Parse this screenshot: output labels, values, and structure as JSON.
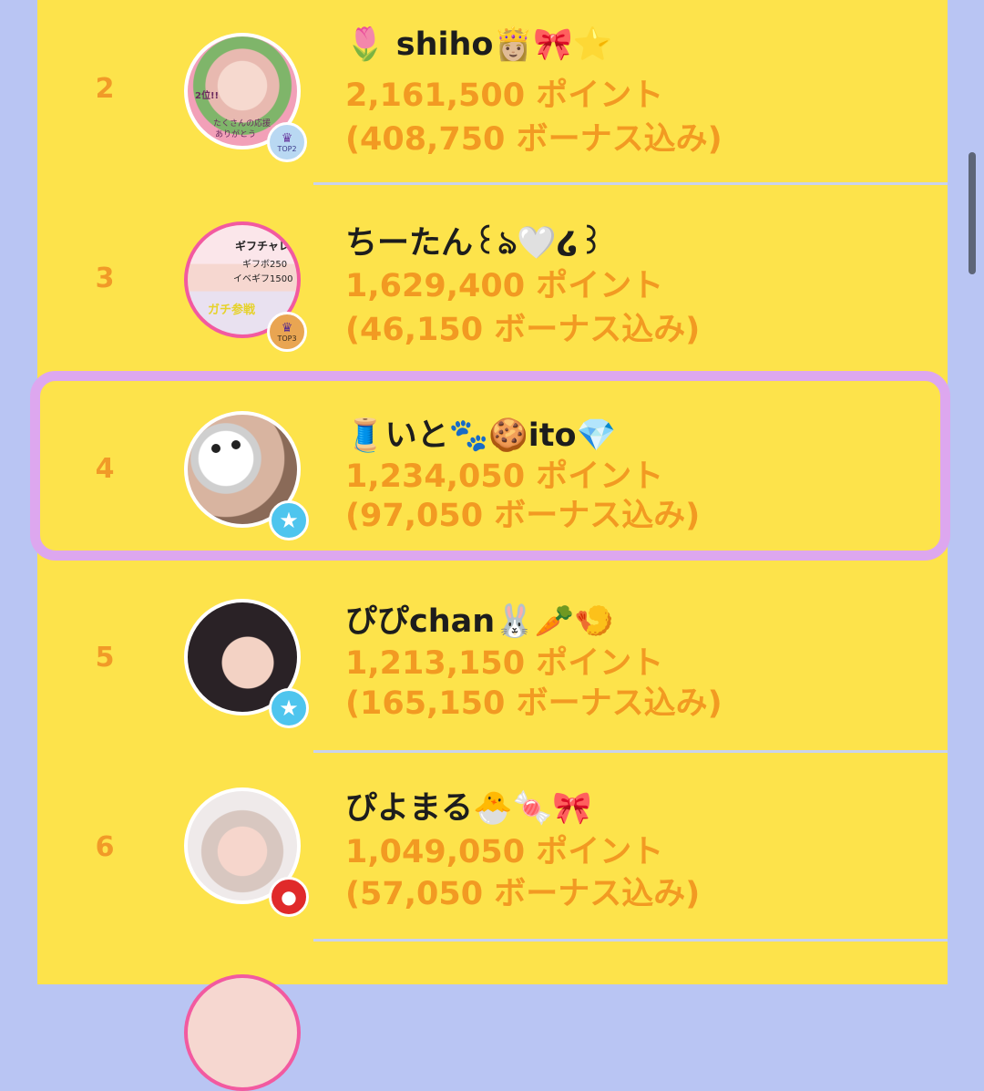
{
  "ranking": [
    {
      "rank": "2",
      "name": "🌷 𝘀𝗵𝗶𝗵𝗼👸🏼🎀⭐️",
      "points": "2,161,500 ポイント",
      "bonus": "(408,750 ボーナス込み)",
      "badge": "TOP2",
      "badge_icon": "crown-icon",
      "avatar_overlay_text": [
        "2位!!",
        "たくさんの応援",
        "ありがとう"
      ]
    },
    {
      "rank": "3",
      "name": "ちーたん꒰ঌ🤍໒꒱",
      "points": "1,629,400 ポイント",
      "bonus": "(46,150 ボーナス込み)",
      "badge": "TOP3",
      "badge_icon": "crown-icon",
      "avatar_overlay_text": [
        "ギフチャレ",
        "ギフボ250",
        "イベギフ1500",
        "ガチ参戦"
      ]
    },
    {
      "rank": "4",
      "name": "🧵いと🐾🍪ito💎",
      "points": "1,234,050 ポイント",
      "bonus": "(97,050 ボーナス込み)",
      "badge": "",
      "badge_icon": "star-icon",
      "highlighted": true
    },
    {
      "rank": "5",
      "name": "ぴぴchan🐰🥕🍤",
      "points": "1,213,150 ポイント",
      "bonus": "(165,150 ボーナス込み)",
      "badge": "",
      "badge_icon": "star-icon"
    },
    {
      "rank": "6",
      "name": "ぴよまる🐣🍬🎀",
      "points": "1,049,050 ポイント",
      "bonus": "(57,050 ボーナス込み)",
      "badge": "",
      "badge_icon": "apple-icon"
    }
  ],
  "colors": {
    "background": "#b9c5f3",
    "panel": "#fde34b",
    "rank_text": "#f19a28",
    "points_text": "#f29a22",
    "name_text": "#1d1d1d",
    "highlight_border": "#dda7ef",
    "separator": "#c9d2ee"
  }
}
